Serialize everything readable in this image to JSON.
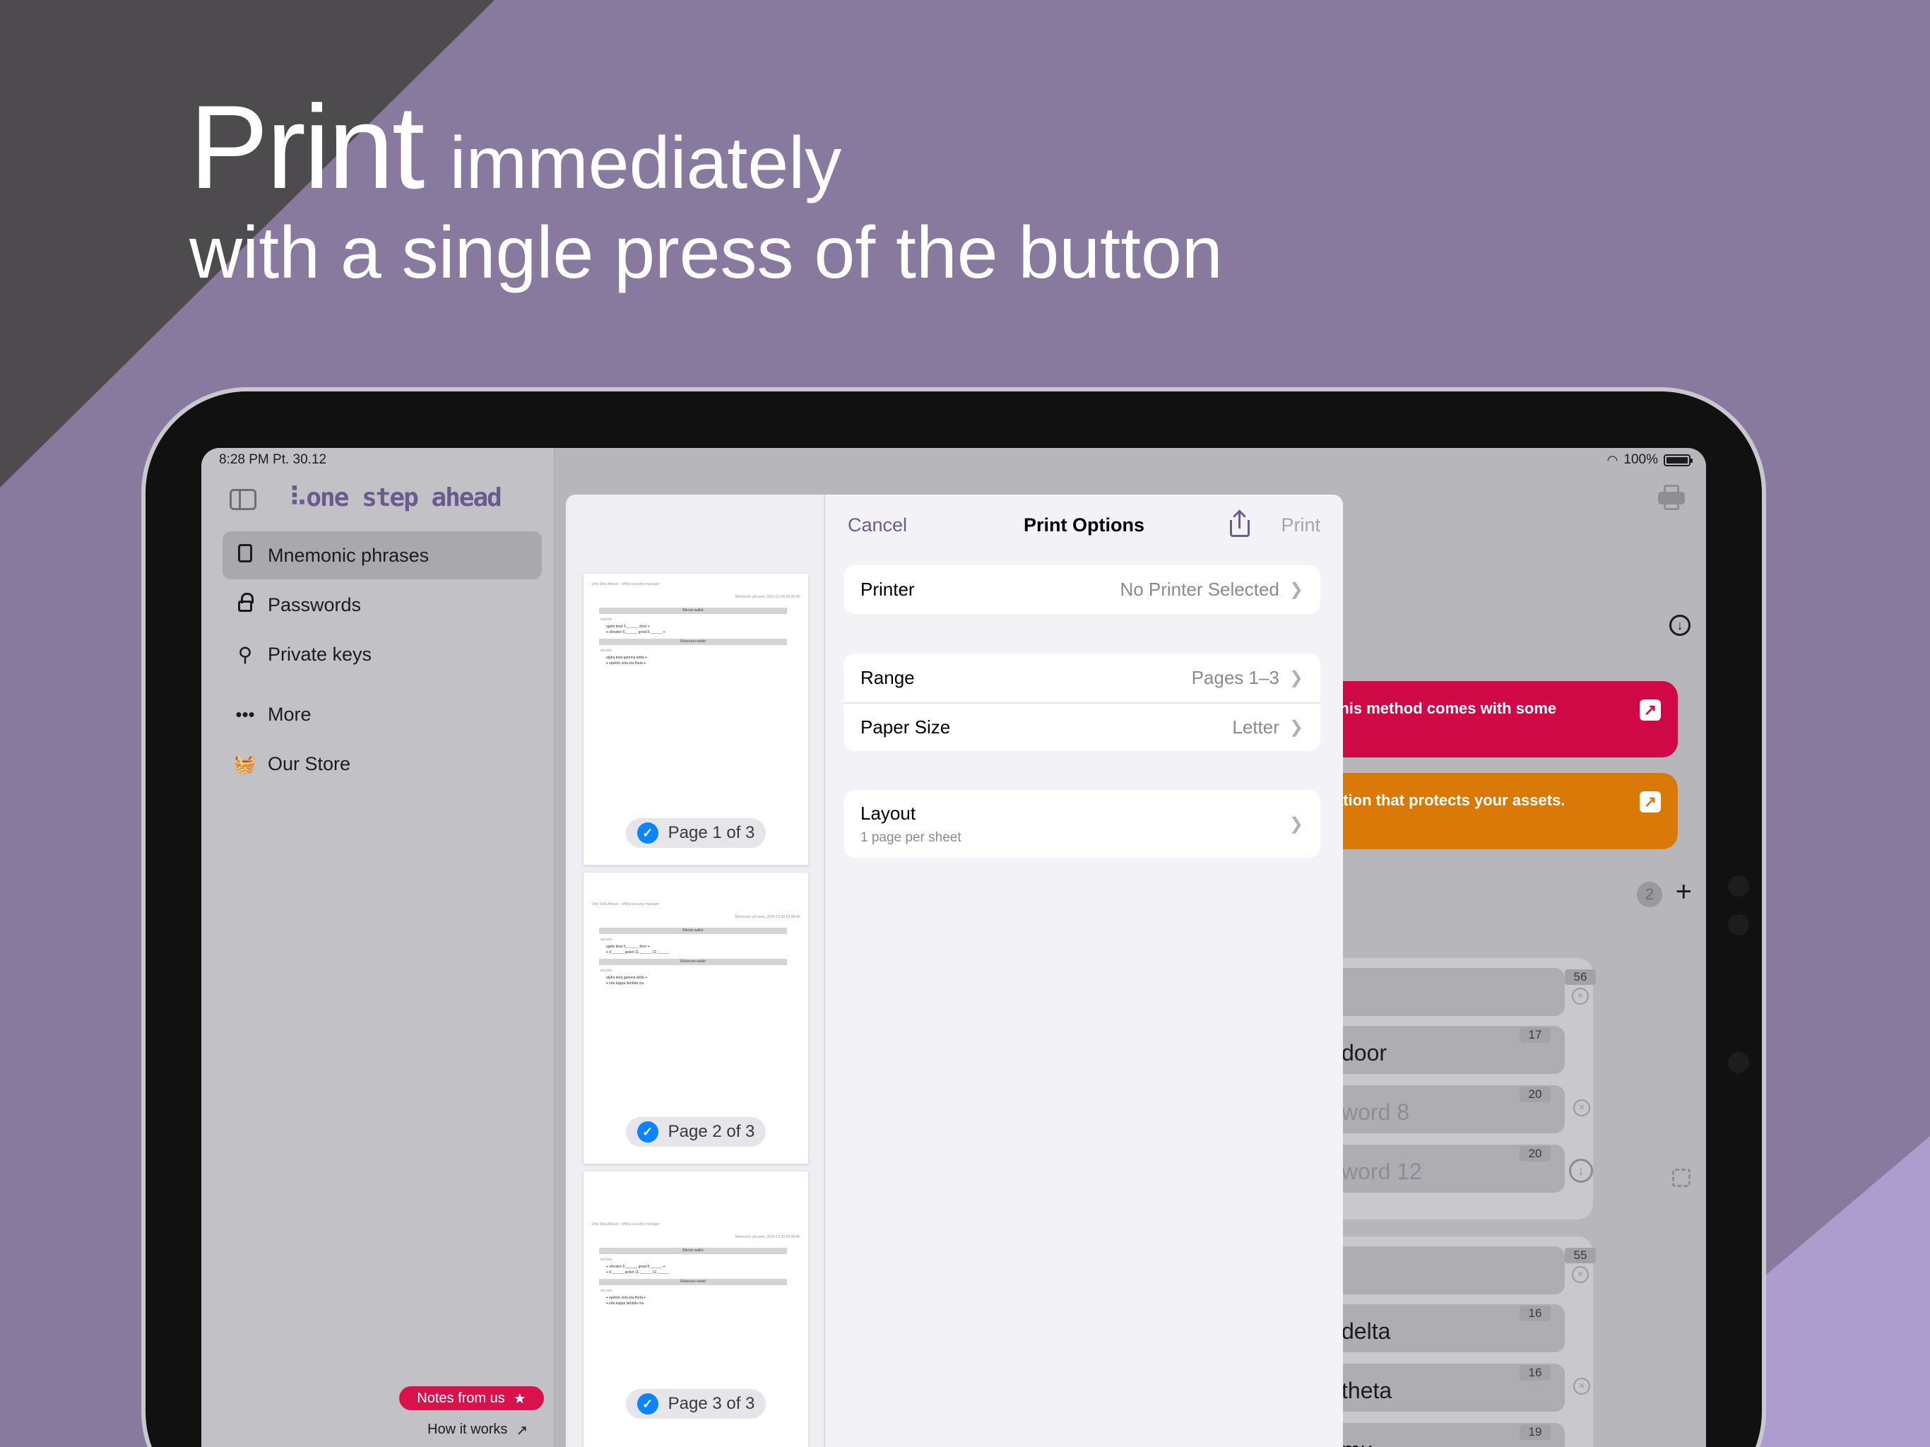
{
  "headline": {
    "big": "Print",
    "small": "immediately",
    "line2": "with a single press of the button"
  },
  "status_bar": {
    "time": "8:28 PM   Pt. 30.12",
    "battery": "100%"
  },
  "sidebar": {
    "logo": "one step ahead",
    "items": [
      {
        "label": "Mnemonic phrases",
        "icon": "document-icon",
        "active": true
      },
      {
        "label": "Passwords",
        "icon": "lock-icon"
      },
      {
        "label": "Private keys",
        "icon": "key-icon"
      },
      {
        "label": "More",
        "icon": "ellipsis-icon"
      },
      {
        "label": "Our Store",
        "icon": "basket-icon"
      }
    ],
    "notes_badge": "Notes from us",
    "how_it_works": "How it works"
  },
  "print_sheet": {
    "cancel": "Cancel",
    "title": "Print Options",
    "print": "Print",
    "printer": {
      "label": "Printer",
      "value": "No Printer Selected"
    },
    "range": {
      "label": "Range",
      "value": "Pages 1–3"
    },
    "paper_size": {
      "label": "Paper Size",
      "value": "Letter"
    },
    "layout": {
      "label": "Layout",
      "sub": "1 page per sheet"
    },
    "pages": [
      "Page 1 of 3",
      "Page 2 of 3",
      "Page 3 of 3"
    ]
  },
  "thumbs": {
    "header_left": "One Step Ahead – offline security manager",
    "header_right": "Mnemonic phrases, 2022-12-30 20:28:40",
    "section_bitcoin": "Bitcoin wallet",
    "section_ethereum": "Ethereum wallet",
    "field_label": "secrets",
    "p1_l1": "apple bear 5.______ door ⌖",
    "p1_l2": "⌖ elevator 6.______ great 8.______ ⌖",
    "p1_l3": "alpha beta gamma delta ⌖",
    "p1_l4": "⌖ epsilon zeta eta theta ⌖",
    "p2_l1": "apple bear 5.______ door ⌖",
    "p2_l2": "⌖ 9.______ jacket 11.______ 12.______",
    "p2_l3": "alpha beta gamma delta ⌖",
    "p2_l4": "⌖ iota kappa lambda mu",
    "p3_l1": "⌖ elevator 6.______ great 8.______ ⌖",
    "p3_l2": "⌖ 9.______ jacket 11.______ 12.______",
    "p3_l3": "⌖ epsilon zeta eta theta ⌖",
    "p3_l4": "⌖ iota kappa lambda mu"
  },
  "background_app": {
    "banner_red": "this method comes with some",
    "banner_orange": "ation that protects your assets.",
    "count": "2",
    "card1": {
      "top_chip": "56",
      "words": [
        {
          "text": "door",
          "chip": "17",
          "placeholder": false
        },
        {
          "text": "word 8",
          "chip": "20",
          "placeholder": true
        },
        {
          "text": "word 12",
          "chip": "20",
          "placeholder": true
        }
      ]
    },
    "card2": {
      "top_chip": "55",
      "words": [
        {
          "text": "delta",
          "chip": "16",
          "placeholder": false
        },
        {
          "text": "theta",
          "chip": "16",
          "placeholder": false
        },
        {
          "text": "mu",
          "chip": "19",
          "placeholder": false
        }
      ]
    }
  },
  "colors": {
    "background": "#887a9e",
    "accent_purple": "#6e5c8e",
    "banner_red": "#cf0945",
    "banner_orange": "#d87908",
    "check_blue": "#0a84ff"
  }
}
